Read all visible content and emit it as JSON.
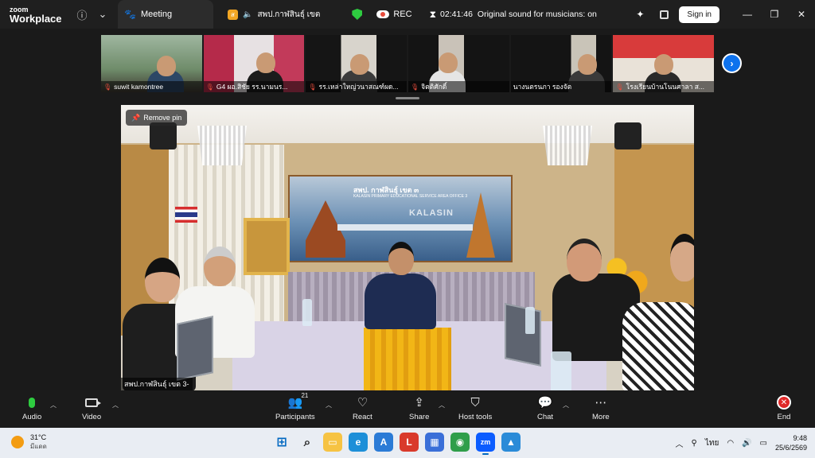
{
  "titlebar": {
    "brand_line1": "zoom",
    "brand_line2": "Workplace",
    "info_icon": "info-icon",
    "chevron_icon": "chevron-down-icon",
    "meeting_tab_label": "Meeting",
    "meeting_name": "สพป.กาฬสินธุ์ เขต",
    "security_icon": "shield-icon",
    "rec_label": "REC",
    "timer": "02:41:46",
    "original_sound": "Original sound for musicians: on",
    "sign_in_label": "Sign in"
  },
  "gallery": {
    "participants": [
      {
        "name": "suwit kamontree",
        "muted": true
      },
      {
        "name": "G4 ผอ.สิชัย  รร.นามนร...",
        "muted": true
      },
      {
        "name": "รร.เหล่าใหญ่วนาสณฑ์ผด...",
        "muted": true
      },
      {
        "name": "จิตติศักดิ์",
        "muted": true
      },
      {
        "name": "นางนตรนภา รองจัต",
        "muted": false
      },
      {
        "name": "โรงเรียนบ้านโนนศาลา ส...",
        "muted": true
      }
    ],
    "next_icon": "chevron-right-icon"
  },
  "main_video": {
    "remove_pin_label": "Remove pin",
    "speaker_name": "สพป.กาฬสินธุ์ เขต 3-",
    "banner_title": "สพป. กาฬสินธุ์ เขต ๓",
    "banner_subtitle": "KALASIN PRIMARY EDUCATIONAL SERVICE AREA OFFICE 3",
    "banner_word": "KALASIN"
  },
  "toolbar": {
    "audio_label": "Audio",
    "video_label": "Video",
    "participants_label": "Participants",
    "participants_count": "21",
    "react_label": "React",
    "share_label": "Share",
    "host_tools_label": "Host tools",
    "chat_label": "Chat",
    "more_label": "More",
    "end_label": "End"
  },
  "taskbar": {
    "temperature": "31°C",
    "condition": "มีแดด",
    "language": "ไทย",
    "time": "9:48",
    "date": "25/6/2569"
  }
}
